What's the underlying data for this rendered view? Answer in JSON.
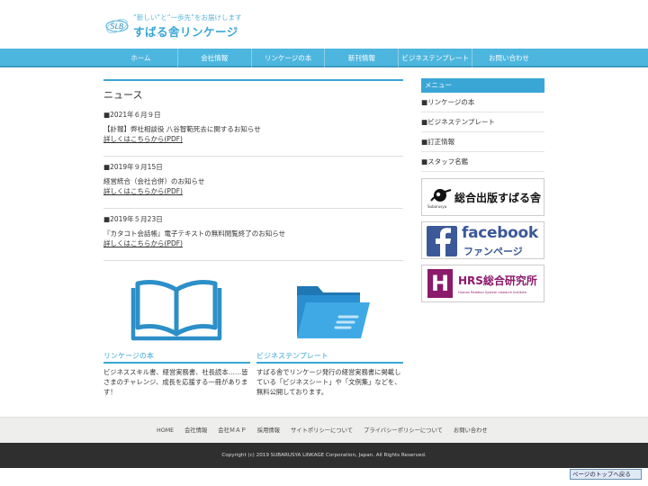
{
  "header": {
    "tagline": "“新しい”と“一歩先”をお届けします",
    "site_name": "すばる舎リンケージ",
    "logo_mark_text": "SLB"
  },
  "nav": {
    "items": [
      "ホーム",
      "会社情報",
      "リンケージの本",
      "新刊情報",
      "ビジネステンプレート",
      "お問い合わせ"
    ]
  },
  "main": {
    "title": "ニュース",
    "news": [
      {
        "date": "■2021年６月９日",
        "title": "【訃報】弊社相談役 八谷智範死去に関するお知らせ",
        "link": "詳しくはこちらから(PDF)"
      },
      {
        "date": "■2019年９月15日",
        "title": "経営統合（会社合併）のお知らせ",
        "link": "詳しくはこちらから(PDF)"
      },
      {
        "date": "■2019年５月23日",
        "title": "『カタコト会話帳』電子テキストの無料閲覧終了のお知らせ",
        "link": "詳しくはこちらから(PDF)"
      }
    ]
  },
  "cards": [
    {
      "title": "リンケージの本",
      "desc": "ビジネススキル書、経営実務書、社長読本……皆さまのチャレンジ、成長を応援する一冊があります！"
    },
    {
      "title": "ビジネステンプレート",
      "desc": "すばる舎でリンケージ発行の経営実務書に掲載している「ビジネスシート」や「文例集」などを、無料公開しております。"
    }
  ],
  "sidebar": {
    "heading": "メニュー",
    "items": [
      "■リンケージの本",
      "■ビジネステンプレート",
      "■訂正情報",
      "■スタッフ名鑑"
    ],
    "banners": [
      {
        "text": "総合出版すばる舎",
        "sub": "Subarusya"
      },
      {
        "text": "facebook",
        "sub": "ファンページ"
      },
      {
        "text": "HRS総合研究所",
        "sub": "Human Relation System research Institute",
        "mark": "H"
      }
    ]
  },
  "footer": {
    "nav": [
      "HOME",
      "会社情報",
      "会社ＭＡＰ",
      "採用情報",
      "サイトポリシーについて",
      "プライバシーポリシーについて",
      "お問い合わせ"
    ],
    "copyright": "Copyright (c) 2019 SUBARUSYA LINKAGE Corporation, Japan. All Rights Reserved.",
    "back_to_top": "ページのトップへ戻る"
  },
  "colors": {
    "accent": "#3aa6d6",
    "nav_bg": "#4db6de",
    "footer_nav_bg": "#eeeeec",
    "footer_copy_bg": "#2f2f2f",
    "facebook_blue": "#3b5998",
    "hrs_purple": "#8b1a6b"
  },
  "icons": [
    "logo-mark-icon",
    "open-book-icon",
    "folder-icon",
    "subaru-logo-icon",
    "facebook-f-icon",
    "hrs-h-icon"
  ]
}
